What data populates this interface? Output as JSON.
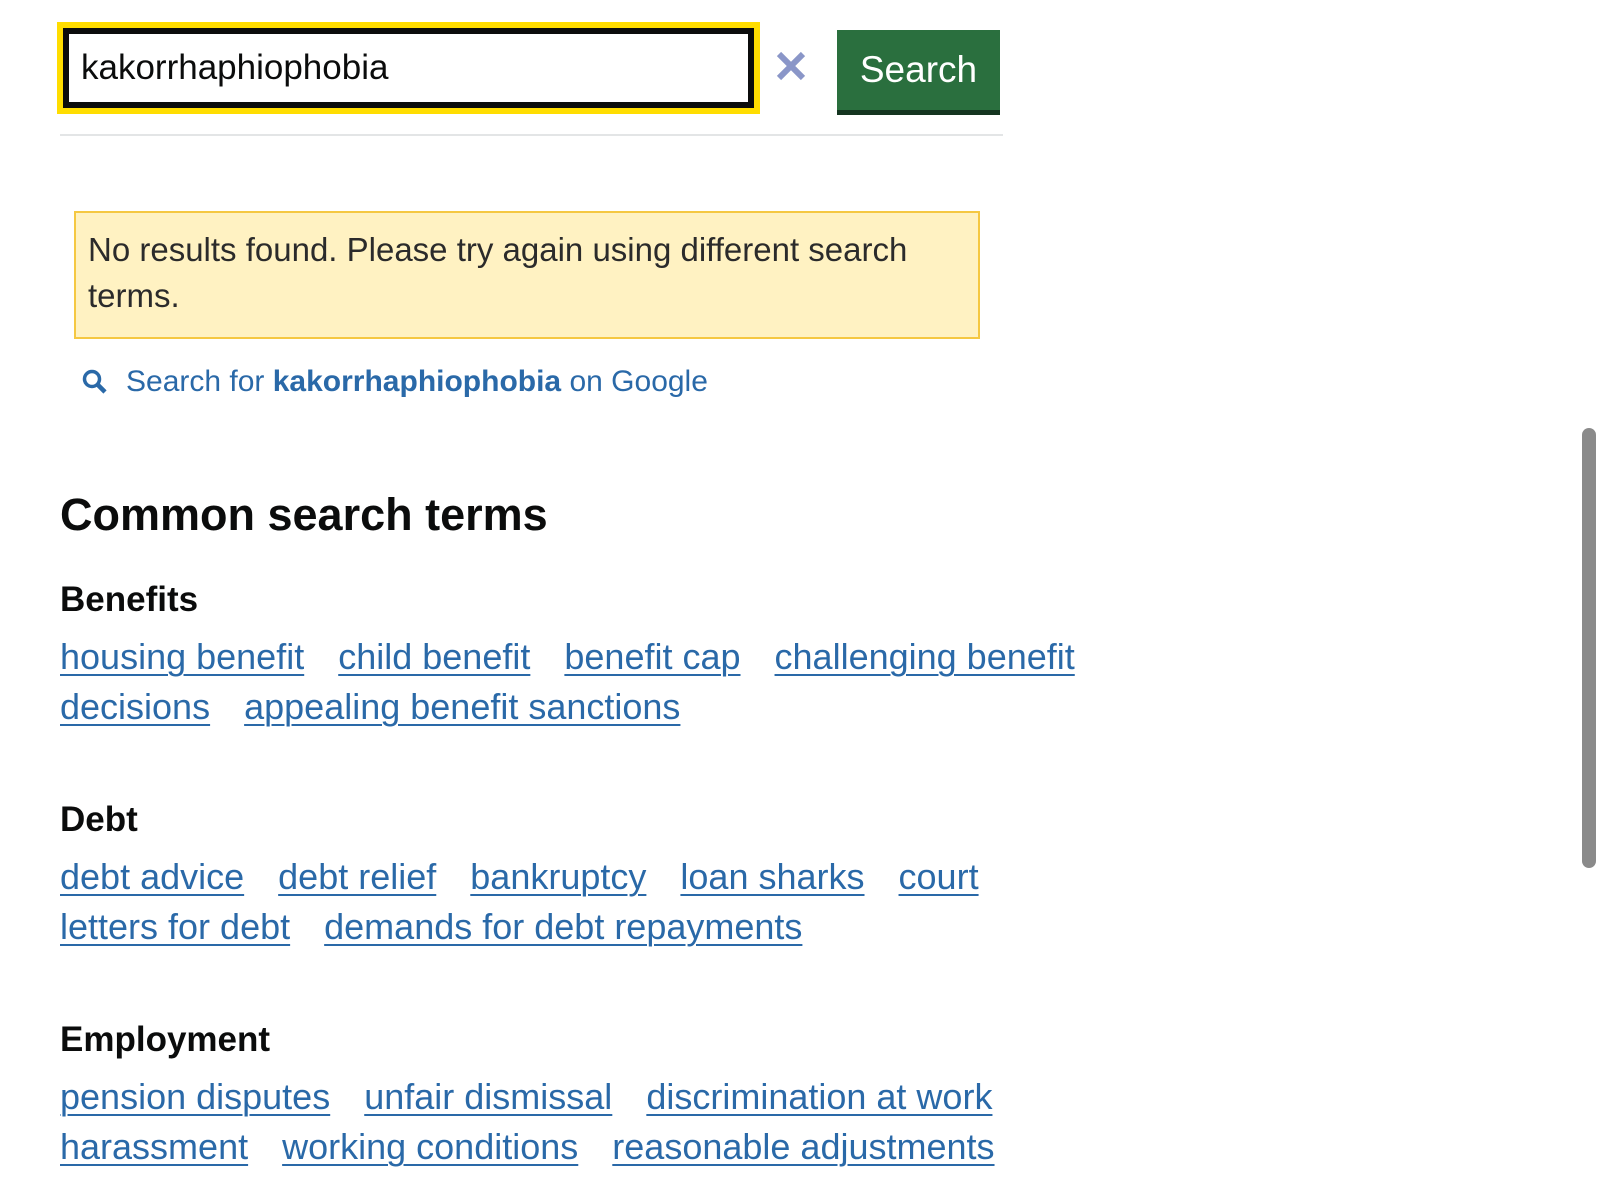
{
  "search": {
    "query": "kakorrhaphiophobia",
    "clear_label": "×",
    "button_label": "Search"
  },
  "notice": {
    "text": "No results found. Please try again using different search terms."
  },
  "google_link": {
    "prefix": "Search for",
    "query": "kakorrhaphiophobia",
    "suffix": "on Google",
    "icon": "search-icon"
  },
  "common_terms": {
    "heading": "Common search terms",
    "categories": [
      {
        "title": "Benefits",
        "terms": [
          "housing benefit",
          "child benefit",
          "benefit cap",
          "challenging benefit decisions",
          "appealing benefit sanctions"
        ]
      },
      {
        "title": "Debt",
        "terms": [
          "debt advice",
          "debt relief",
          "bankruptcy",
          "loan sharks",
          "court letters for debt",
          "demands for debt repayments"
        ]
      },
      {
        "title": "Employment",
        "terms": [
          "pension disputes",
          "unfair dismissal",
          "discrimination at work",
          "harassment",
          "working conditions",
          "reasonable adjustments"
        ]
      }
    ]
  },
  "colors": {
    "focus": "#ffdd00",
    "button": "#2a6f3e",
    "link": "#2a69a8",
    "notice_bg": "#fff2c2",
    "notice_border": "#f5c842"
  }
}
